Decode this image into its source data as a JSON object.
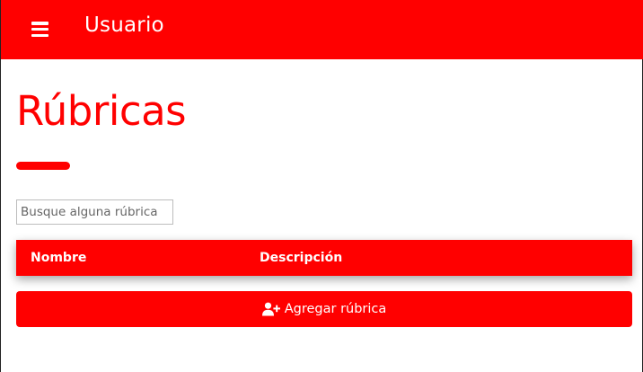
{
  "header": {
    "menu_icon": "hamburger-menu-icon",
    "title": "Usuario"
  },
  "page": {
    "title": "Rúbricas"
  },
  "search": {
    "placeholder": "Busque alguna rúbrica",
    "value": ""
  },
  "table": {
    "columns": [
      "Nombre",
      "Descripción"
    ],
    "rows": []
  },
  "actions": {
    "add_label": "Agregar rúbrica",
    "add_icon": "user-plus-icon"
  },
  "colors": {
    "primary": "#ff0000",
    "background": "#ffffff"
  }
}
